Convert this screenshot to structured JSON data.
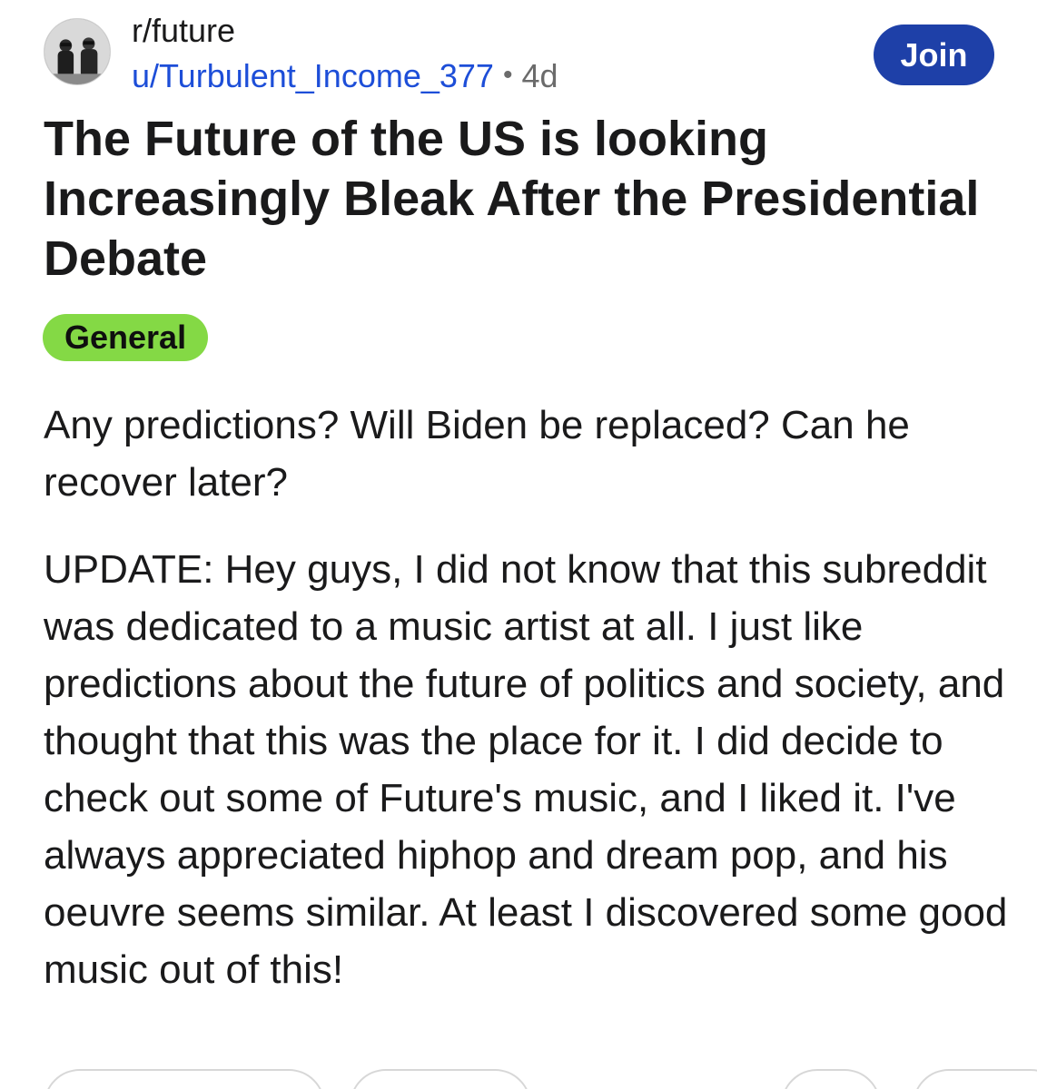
{
  "post": {
    "subreddit": "r/future",
    "username": "u/Turbulent_Income_377",
    "separator": "•",
    "age": "4d",
    "join_label": "Join",
    "title": "The Future of the US is looking Increasingly Bleak After the Presidential Debate",
    "flair": "General",
    "paragraphs": [
      "Any predictions? Will Biden be replaced? Can he recover later?",
      "UPDATE: Hey guys, I did not know that this subreddit was dedicated to a music artist at all. I just like predictions about the future of politics and society, and thought that this was the place for it. I did decide to check out some of Future's music, and I liked it. I've always appreciated hiphop and dream pop, and his oeuvre seems similar. At least I discovered some good music out of this!"
    ]
  },
  "colors": {
    "join_bg": "#1e40a8",
    "username": "#1d4ed8",
    "flair_bg": "#84d945"
  },
  "icons": {
    "avatar": "subreddit-avatar"
  }
}
